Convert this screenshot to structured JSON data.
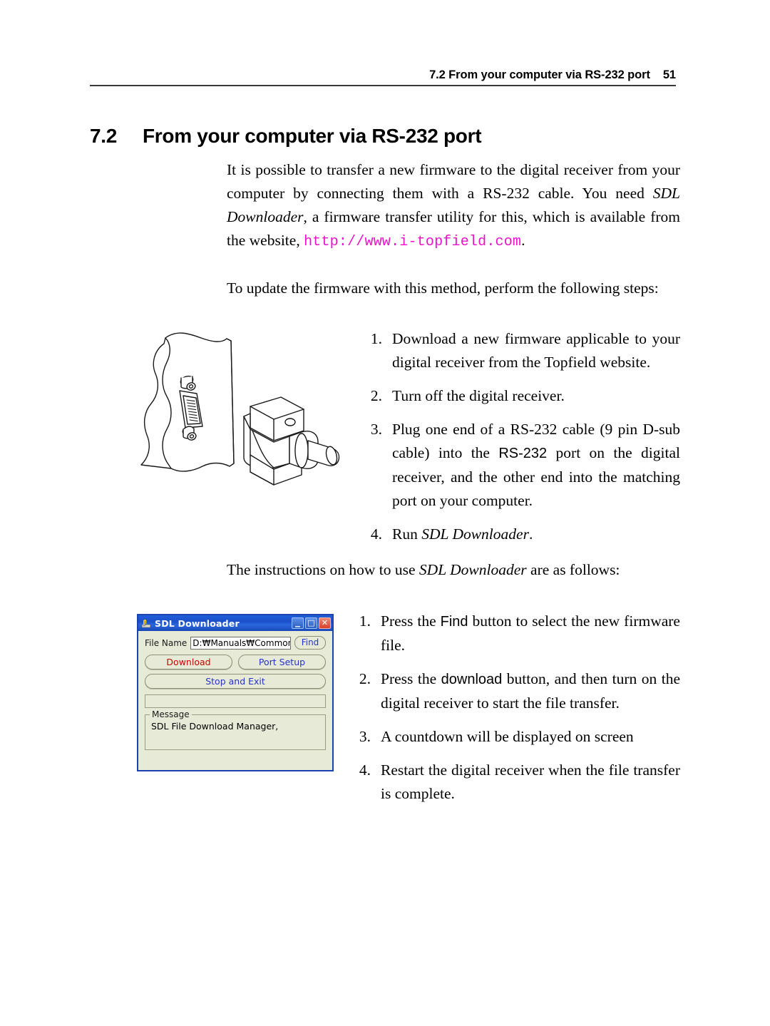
{
  "header": {
    "running_title": "7.2 From your computer via RS-232 port",
    "page_number": "51"
  },
  "section": {
    "number": "7.2",
    "title": "From your computer via RS-232 port"
  },
  "body": {
    "para1_a": "It is possible to transfer a new firmware to the digital receiver from your computer by connecting them with a RS-232 cable. You need ",
    "para1_italic": "SDL Downloader",
    "para1_b": ", a firmware transfer utility for this, which is available from the website, ",
    "para1_url": "http://www.i-topfield.com",
    "para1_c": ".",
    "para2": "To update the firmware with this method, perform the following steps:",
    "para3_a": "The instructions on how to use ",
    "para3_italic": "SDL Downloader",
    "para3_b": " are as follows:"
  },
  "steps_setup": [
    {
      "marker": "1.",
      "text": "Download a new firmware applicable to your digital receiver from the Topfield website."
    },
    {
      "marker": "2.",
      "text": "Turn off the digital receiver."
    },
    {
      "marker": "3.",
      "text_a": "Plug one end of a RS-232 cable (9 pin D-sub cable) into the ",
      "text_sans": "RS-232",
      "text_b": " port on the digital receiver, and the other end into the matching port on your computer."
    },
    {
      "marker": "4.",
      "text_a": "Run ",
      "text_italic": "SDL Downloader",
      "text_b": "."
    }
  ],
  "steps_usage": [
    {
      "marker": "1.",
      "text_a": "Press the ",
      "text_sans": "Find",
      "text_b": " button to select the new firmware file."
    },
    {
      "marker": "2.",
      "text_a": "Press the ",
      "text_sans": "download",
      "text_b": " button, and then turn on the digital receiver to start the file transfer."
    },
    {
      "marker": "3.",
      "text": "A countdown will be displayed on screen"
    },
    {
      "marker": "4.",
      "text": "Restart the digital receiver when the file transfer is complete."
    }
  ],
  "sdl_window": {
    "title": "SDL Downloader",
    "minimize_glyph": "_",
    "maximize_glyph": "□",
    "close_glyph": "✕",
    "file_name_label": "File Name",
    "file_name_value": "D:₩Manuals₩Common₩",
    "find_button": "Find",
    "download_button": "Download",
    "port_setup_button": "Port Setup",
    "stop_exit_button": "Stop and Exit",
    "message_legend": "Message",
    "message_text": "SDL File Download Manager,",
    "colors": {
      "titlebar": "#1b4fc8",
      "face": "#e8ead8",
      "download_text": "#cc0000",
      "link_text": "#2633c8",
      "close_button": "#d8402a"
    }
  },
  "figure": {
    "caption": "",
    "name": "rs-232-connector-illustration"
  },
  "colors": {
    "url_magenta": "#ee11cc",
    "rule": "#3a3a3a",
    "text": "#000000"
  }
}
